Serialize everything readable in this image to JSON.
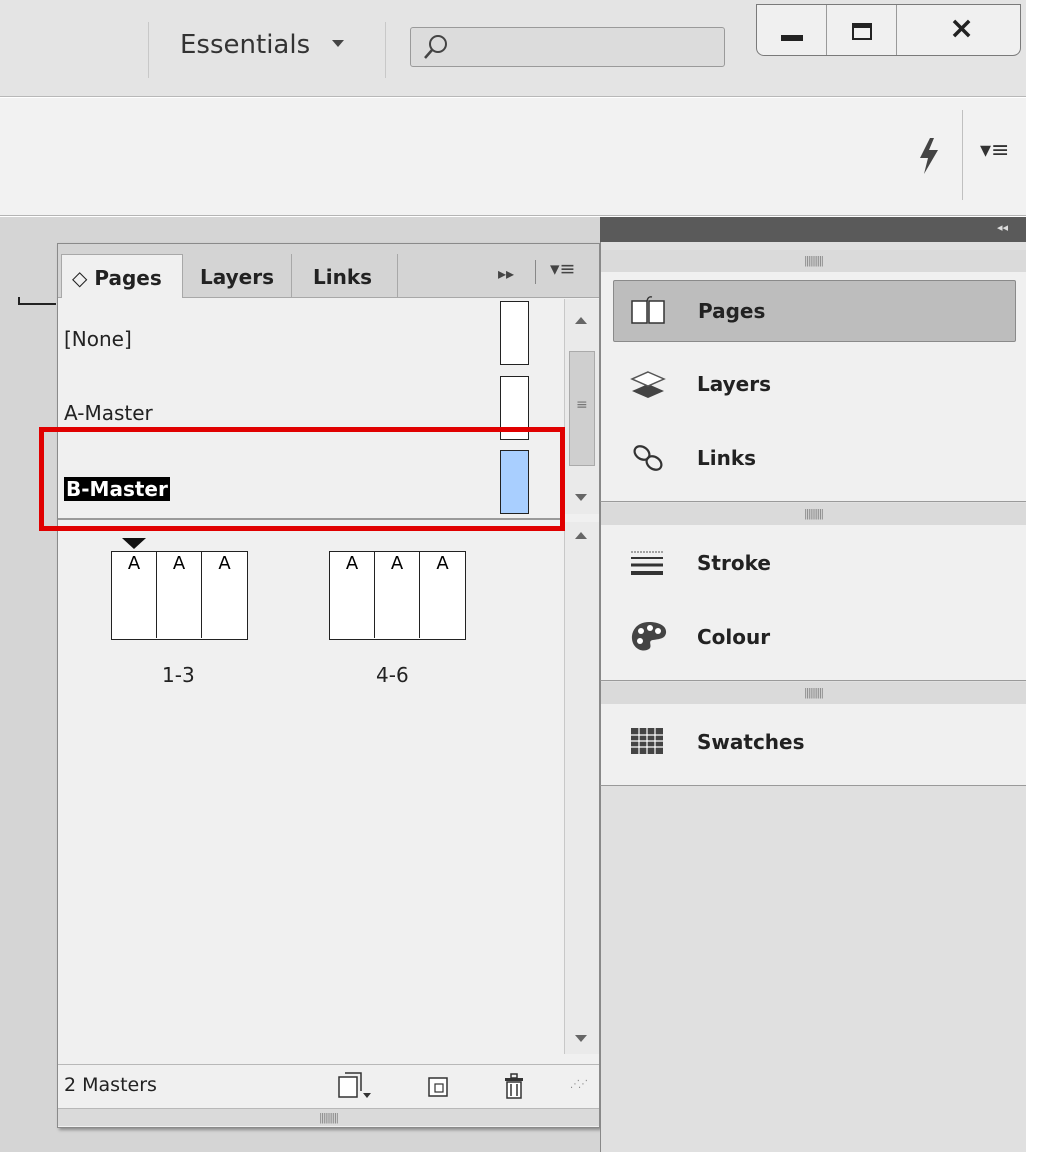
{
  "titlebar": {
    "workspace": "Essentials",
    "search_placeholder": "",
    "icons": [
      "chevron-down-icon",
      "search-icon",
      "minimize-icon",
      "maximize-icon",
      "close-icon"
    ]
  },
  "controlbar": {
    "icons": [
      "lightning-icon",
      "panel-menu-icon"
    ]
  },
  "pages_panel": {
    "tabs": [
      {
        "label": "◇ Pages",
        "active": true
      },
      {
        "label": "Layers",
        "active": false
      },
      {
        "label": "Links",
        "active": false
      }
    ],
    "masters": [
      {
        "label": "[None]",
        "selected": false
      },
      {
        "label": "A-Master",
        "selected": false
      },
      {
        "label": "B-Master",
        "selected": true
      }
    ],
    "spreads": [
      {
        "pages": [
          "A",
          "A",
          "A"
        ],
        "label": "1-3"
      },
      {
        "pages": [
          "A",
          "A",
          "A"
        ],
        "label": "4-6"
      }
    ],
    "status": "2 Masters",
    "colors": {
      "selected_thumb": "#a9cfff",
      "highlight_box": "#e00000"
    }
  },
  "dock": {
    "groups": [
      {
        "items": [
          {
            "label": "Pages",
            "icon": "pages-icon",
            "active": true
          },
          {
            "label": "Layers",
            "icon": "layers-icon",
            "active": false
          },
          {
            "label": "Links",
            "icon": "links-icon",
            "active": false
          }
        ]
      },
      {
        "items": [
          {
            "label": "Stroke",
            "icon": "stroke-icon",
            "active": false
          },
          {
            "label": "Colour",
            "icon": "palette-icon",
            "active": false
          }
        ]
      },
      {
        "items": [
          {
            "label": "Swatches",
            "icon": "swatches-icon",
            "active": false
          }
        ]
      }
    ]
  }
}
